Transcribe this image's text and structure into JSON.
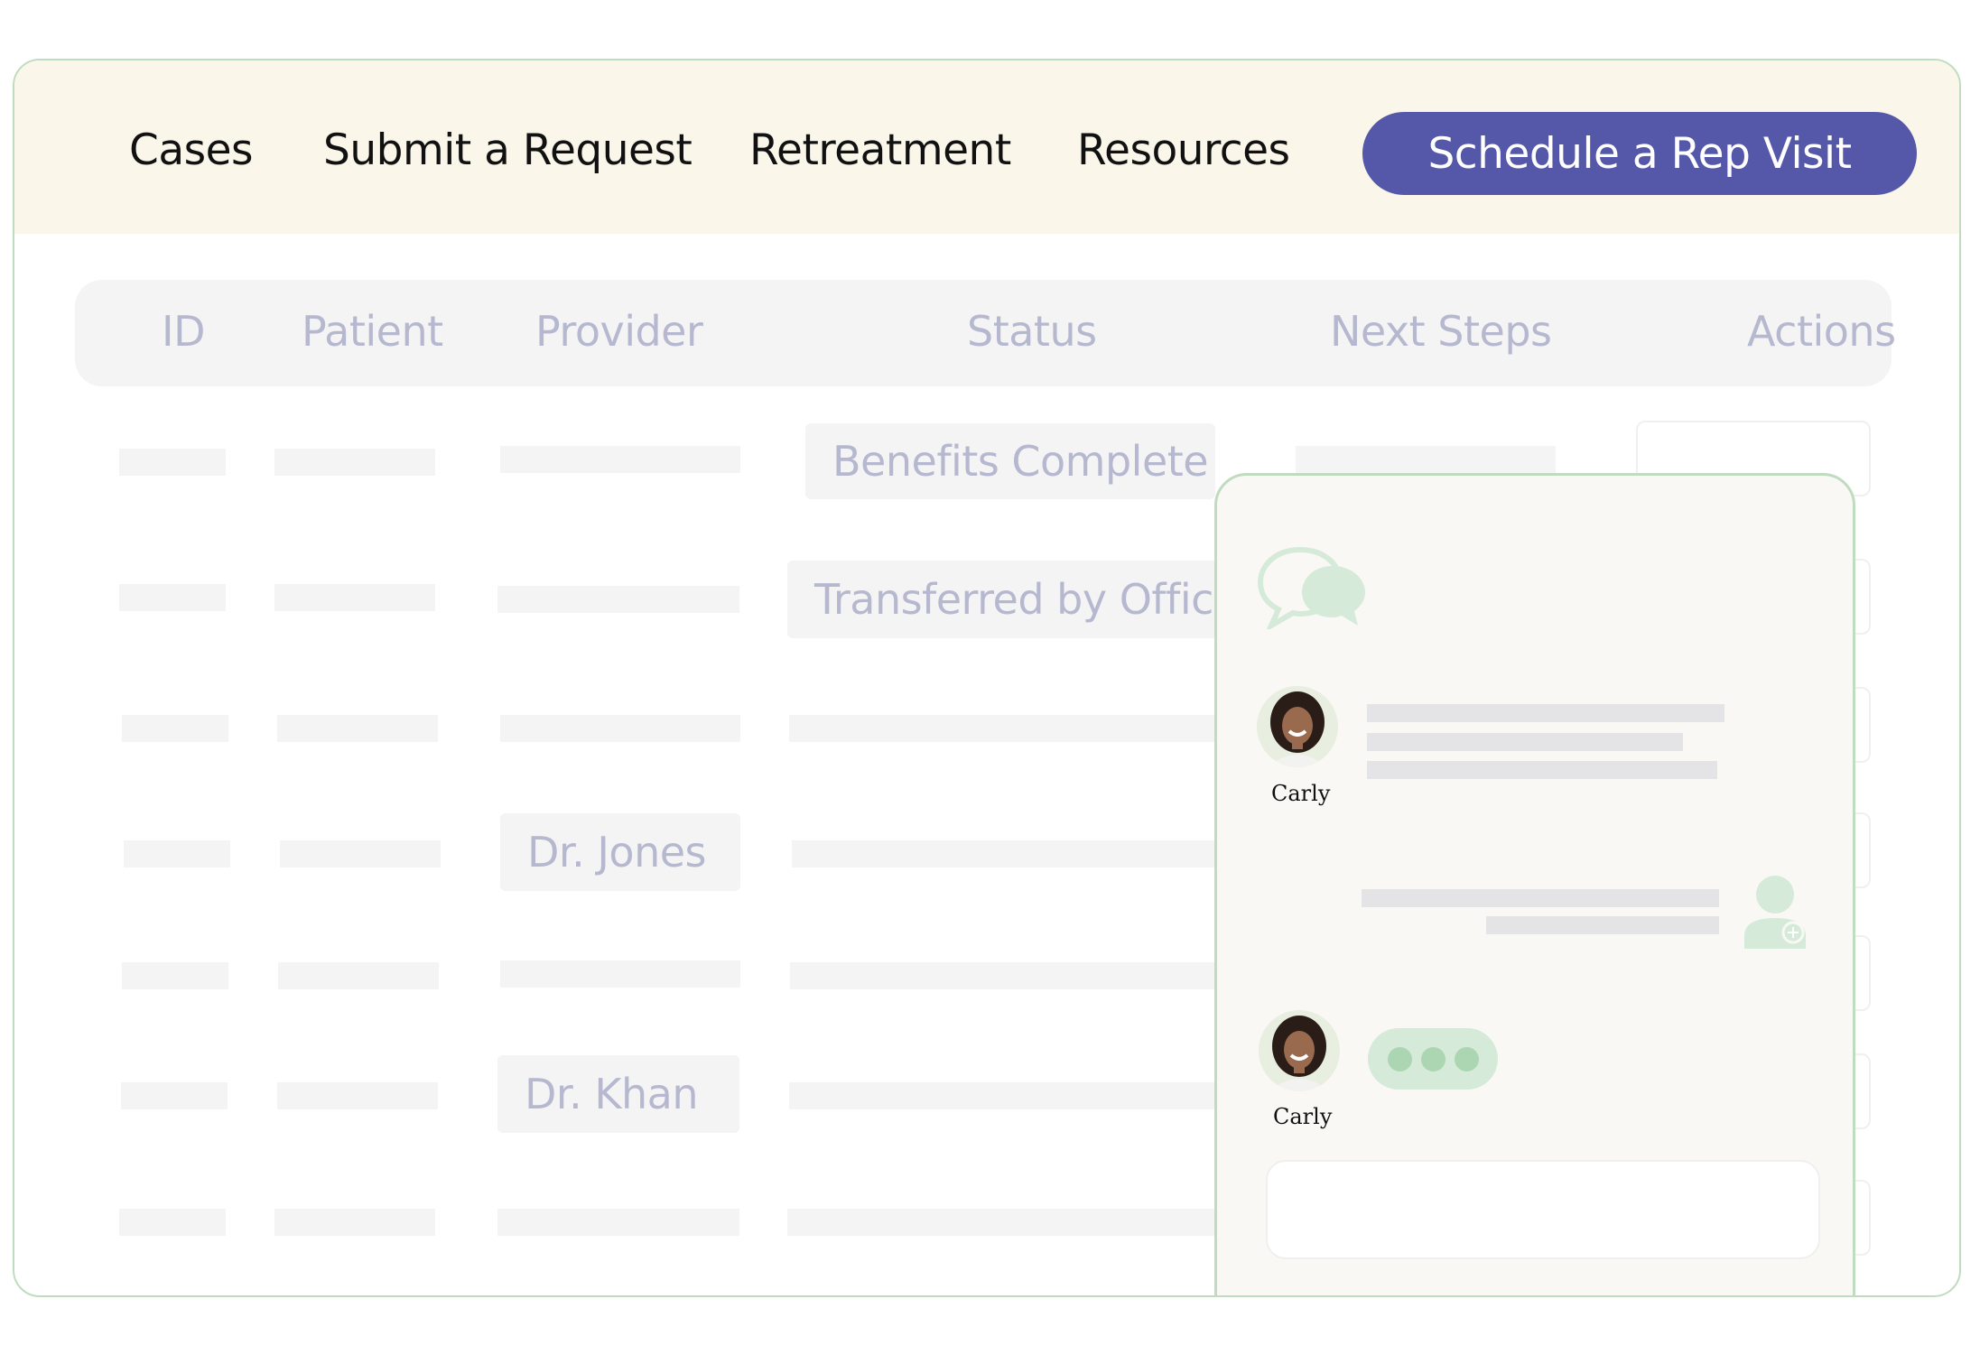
{
  "nav": {
    "links": [
      "Cases",
      "Submit a Request",
      "Retreatment",
      "Resources"
    ],
    "cta_label": "Schedule a Rep Visit"
  },
  "colors": {
    "cta_bg": "#5558a8",
    "header_bar": "#faf7ea",
    "frame_border": "#bfdcc0",
    "muted_text": "#b6b8cf",
    "chat_green": "#d5ead8"
  },
  "table": {
    "columns": [
      "ID",
      "Patient",
      "Provider",
      "Status",
      "Next Steps",
      "Actions"
    ],
    "rows": [
      {
        "status": "Benefits Complete",
        "provider": ""
      },
      {
        "status": "Transferred by Office",
        "provider": ""
      },
      {
        "status": "",
        "provider": ""
      },
      {
        "status": "",
        "provider": "Dr. Jones"
      },
      {
        "status": "",
        "provider": ""
      },
      {
        "status": "",
        "provider": "Dr. Khan"
      },
      {
        "status": "",
        "provider": ""
      }
    ]
  },
  "chat": {
    "logo_icon": "chat-bubbles-icon",
    "agent_name": "Carly",
    "user_icon": "user-add-icon"
  }
}
